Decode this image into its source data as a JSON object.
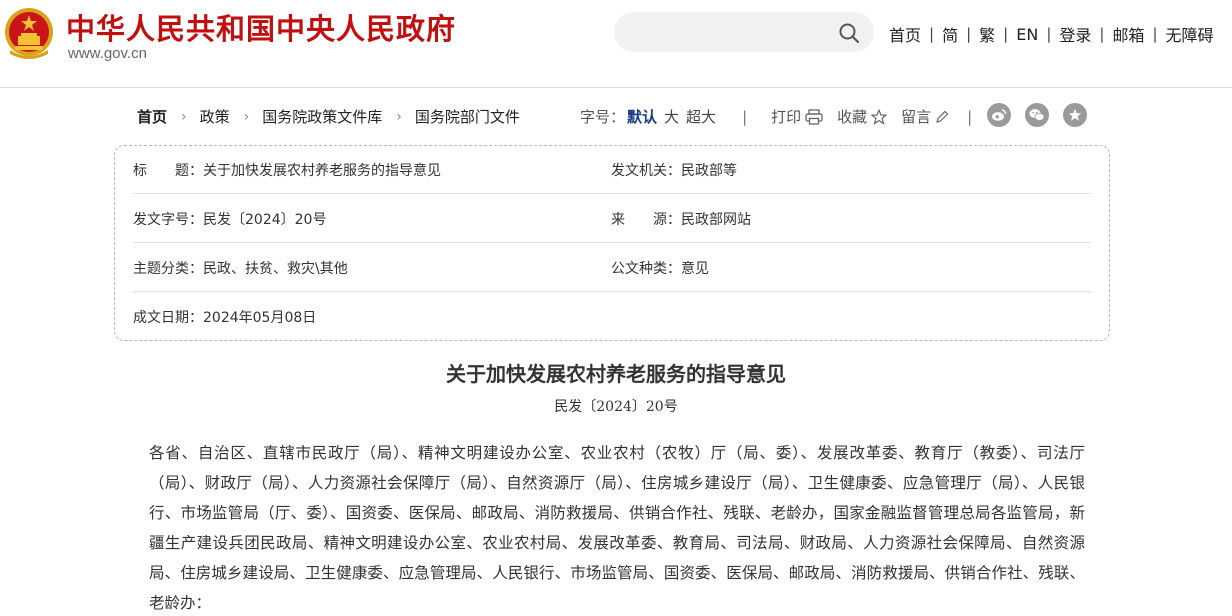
{
  "header": {
    "site_title": "中华人民共和国中央人民政府",
    "site_domain": "www.gov.cn",
    "search": {
      "placeholder": ""
    },
    "nav": [
      "首页",
      "简",
      "繁",
      "EN",
      "登录",
      "邮箱",
      "无障碍"
    ]
  },
  "breadcrumb": [
    "首页",
    "政策",
    "国务院政策文件库",
    "国务院部门文件"
  ],
  "tools": {
    "font_size_label": "字号：",
    "font_sizes": [
      "默认",
      "大",
      "超大"
    ],
    "print": "打印",
    "favorite": "收藏",
    "comment": "留言",
    "social": [
      "weibo-icon",
      "wechat-icon",
      "star-share-icon"
    ]
  },
  "info": {
    "title_label": "标　　题：",
    "title_value": "关于加快发展农村养老服务的指导意见",
    "issuer_label": "发文机关：",
    "issuer_value": "民政部等",
    "doc_no_label": "发文字号：",
    "doc_no_value": "民发〔2024〕20号",
    "source_label": "来　　源：",
    "source_value": "民政部网站",
    "topic_label": "主题分类：",
    "topic_value": "民政、扶贫、救灾\\其他",
    "type_label": "公文种类：",
    "type_value": "意见",
    "date_label": "成文日期：",
    "date_value": "2024年05月08日"
  },
  "article": {
    "title": "关于加快发展农村养老服务的指导意见",
    "doc_number": "民发〔2024〕20号",
    "body": "各省、自治区、直辖市民政厅（局）、精神文明建设办公室、农业农村（农牧）厅（局、委）、发展改革委、教育厅（教委）、司法厅（局）、财政厅（局）、人力资源社会保障厅（局）、自然资源厅（局）、住房城乡建设厅（局）、卫生健康委、应急管理厅（局）、人民银行、市场监管局（厅、委）、国资委、医保局、邮政局、消防救援局、供销合作社、残联、老龄办，国家金融监督管理总局各监管局，新疆生产建设兵团民政局、精神文明建设办公室、农业农村局、发展改革委、教育局、司法局、财政局、人力资源社会保障局、自然资源局、住房城乡建设局、卫生健康委、应急管理局、人民银行、市场监管局、国资委、医保局、邮政局、消防救援局、供销合作社、残联、老龄办："
  },
  "colors": {
    "brand_red": "#c21010",
    "active_blue": "#1a3a8a",
    "icon_gray": "#9a9a9a"
  }
}
